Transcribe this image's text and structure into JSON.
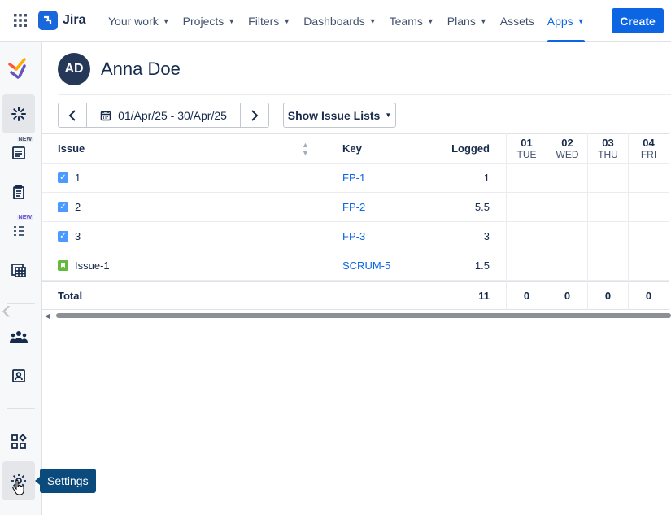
{
  "topbar": {
    "logo_text": "Jira",
    "nav": [
      {
        "label": "Your work",
        "chevron": true
      },
      {
        "label": "Projects",
        "chevron": true
      },
      {
        "label": "Filters",
        "chevron": true
      },
      {
        "label": "Dashboards",
        "chevron": true
      },
      {
        "label": "Teams",
        "chevron": true
      },
      {
        "label": "Plans",
        "chevron": true
      },
      {
        "label": "Assets",
        "chevron": false
      },
      {
        "label": "Apps",
        "chevron": true,
        "active": true
      }
    ],
    "create_label": "Create"
  },
  "sidebar": {
    "new_badge": "NEW",
    "tooltip": "Settings"
  },
  "user": {
    "initials": "AD",
    "name": "Anna Doe"
  },
  "toolbar": {
    "date_range": "01/Apr/25 - 30/Apr/25",
    "show_issue_lists": "Show Issue Lists"
  },
  "table": {
    "headers": {
      "issue": "Issue",
      "key": "Key",
      "logged": "Logged"
    },
    "rows": [
      {
        "issue": "1",
        "type": "task",
        "key": "FP-1",
        "logged": "1"
      },
      {
        "issue": "2",
        "type": "task",
        "key": "FP-2",
        "logged": "5.5"
      },
      {
        "issue": "3",
        "type": "task",
        "key": "FP-3",
        "logged": "3"
      },
      {
        "issue": "Issue-1",
        "type": "story",
        "key": "SCRUM-5",
        "logged": "1.5"
      }
    ],
    "total_label": "Total",
    "total_logged": "11",
    "days": [
      {
        "num": "01",
        "name": "TUE",
        "total": "0"
      },
      {
        "num": "02",
        "name": "WED",
        "total": "0"
      },
      {
        "num": "03",
        "name": "THU",
        "total": "0"
      },
      {
        "num": "04",
        "name": "FRI",
        "total": "0"
      }
    ]
  },
  "colors": {
    "accent": "#0c66e4",
    "avatar_bg": "#253858",
    "tooltip_bg": "#0b4a7d"
  }
}
